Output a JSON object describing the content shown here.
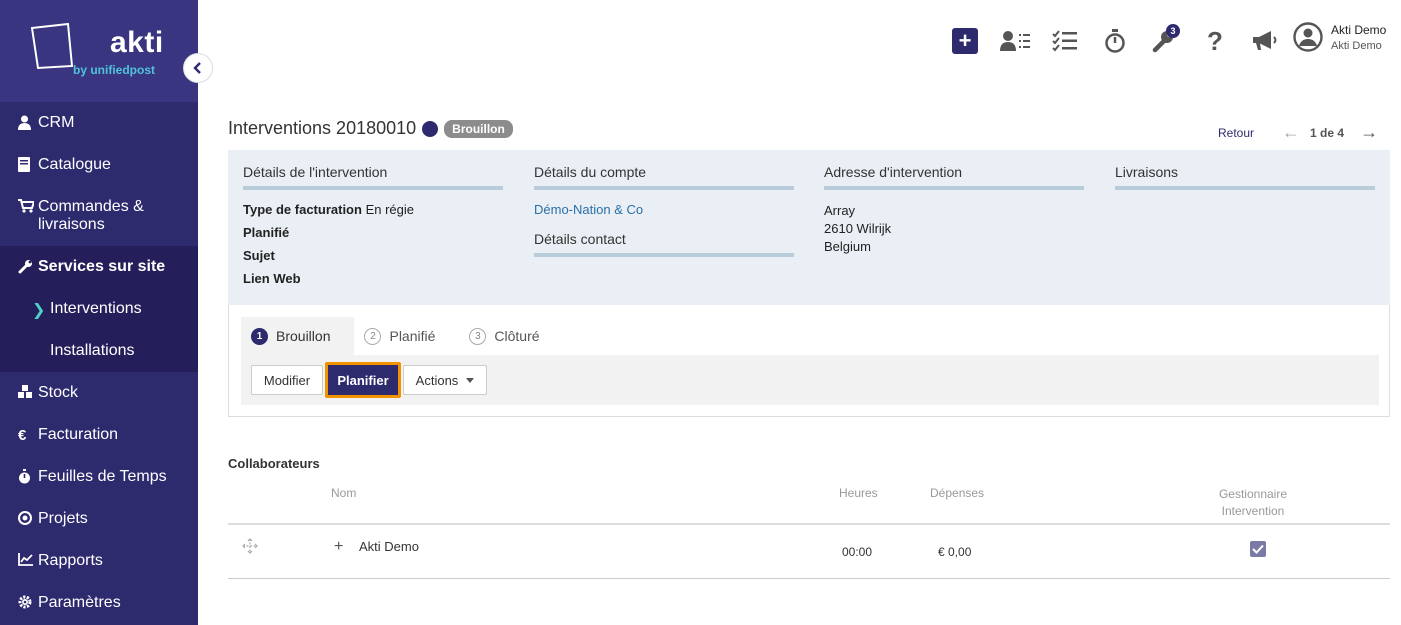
{
  "brand": {
    "name": "akti",
    "tagline": "by unifiedpost"
  },
  "sidebar": {
    "items": [
      {
        "label": "CRM",
        "icon": "user-icon"
      },
      {
        "label": "Catalogue",
        "icon": "book-icon"
      },
      {
        "label": "Commandes & livraisons",
        "icon": "cart-icon"
      },
      {
        "label": "Services sur site",
        "icon": "wrench-icon"
      },
      {
        "label": "Stock",
        "icon": "boxes-icon"
      },
      {
        "label": "Facturation",
        "icon": "euro-icon"
      },
      {
        "label": "Feuilles de Temps",
        "icon": "stopwatch-icon"
      },
      {
        "label": "Projets",
        "icon": "target-icon"
      },
      {
        "label": "Rapports",
        "icon": "chart-icon"
      },
      {
        "label": "Paramètres",
        "icon": "gear-icon"
      }
    ],
    "subitems": [
      {
        "label": "Interventions"
      },
      {
        "label": "Installations"
      }
    ]
  },
  "topbar": {
    "notification_count": "3",
    "user_name": "Akti Demo",
    "user_company": "Akti Demo"
  },
  "page": {
    "title": "Interventions 20180010",
    "status": "Brouillon",
    "back_label": "Retour",
    "pager": "1 de 4"
  },
  "details": {
    "intervention": {
      "heading": "Détails de l'intervention",
      "billing_label": "Type de facturation",
      "billing_value": "En régie",
      "planned_label": "Planifié",
      "subject_label": "Sujet",
      "weblink_label": "Lien Web"
    },
    "account": {
      "heading": "Détails du compte",
      "company": "Démo-Nation & Co",
      "contact_heading": "Détails contact"
    },
    "address": {
      "heading": "Adresse d'intervention",
      "line1": "Array",
      "line2": "2610 Wilrijk",
      "line3": "Belgium"
    },
    "deliveries": {
      "heading": "Livraisons"
    }
  },
  "workflow": {
    "steps": [
      {
        "num": "1",
        "label": "Brouillon"
      },
      {
        "num": "2",
        "label": "Planifié"
      },
      {
        "num": "3",
        "label": "Clôturé"
      }
    ],
    "buttons": {
      "edit": "Modifier",
      "plan": "Planifier",
      "actions": "Actions"
    }
  },
  "collaborators": {
    "title": "Collaborateurs",
    "headers": {
      "name": "Nom",
      "hours": "Heures",
      "expenses": "Dépenses",
      "manager_line1": "Gestionnaire",
      "manager_line2": "Intervention"
    },
    "rows": [
      {
        "name": "Akti Demo",
        "hours": "00:00",
        "expenses": "€ 0,00",
        "manager": true
      }
    ]
  },
  "colors": {
    "sidebar": "#2e2a6e",
    "accent_teal": "#4fc3d8",
    "highlight": "#f39200",
    "panel": "#e9eff4"
  }
}
